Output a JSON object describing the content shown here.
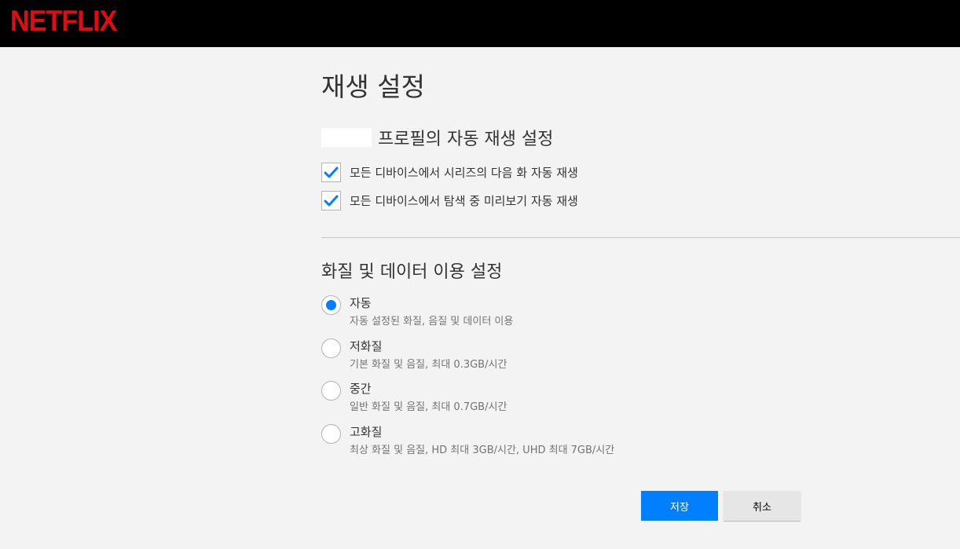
{
  "header": {
    "logo_text": "NETFLIX",
    "logo_color": "#e50914"
  },
  "page": {
    "title": "재생 설정"
  },
  "autoplay": {
    "heading": "프로필의 자동 재생 설정",
    "options": [
      {
        "label": "모든 디바이스에서 시리즈의 다음 화 자동 재생",
        "checked": true
      },
      {
        "label": "모든 디바이스에서 탐색 중 미리보기 자동 재생",
        "checked": true
      }
    ]
  },
  "quality": {
    "heading": "화질 및 데이터 이용 설정",
    "options": [
      {
        "label": "자동",
        "desc": "자동 설정된 화질, 음질 및 데이터 이용",
        "selected": true
      },
      {
        "label": "저화질",
        "desc": "기본 화질 및 음질, 최대 0.3GB/시간",
        "selected": false
      },
      {
        "label": "중간",
        "desc": "일반 화질 및 음질, 최대 0.7GB/시간",
        "selected": false
      },
      {
        "label": "고화질",
        "desc": "최상 화질 및 음질, HD 최대 3GB/시간, UHD 최대 7GB/시간",
        "selected": false
      }
    ]
  },
  "actions": {
    "save_label": "저장",
    "cancel_label": "취소",
    "accent_color": "#0080ff"
  }
}
